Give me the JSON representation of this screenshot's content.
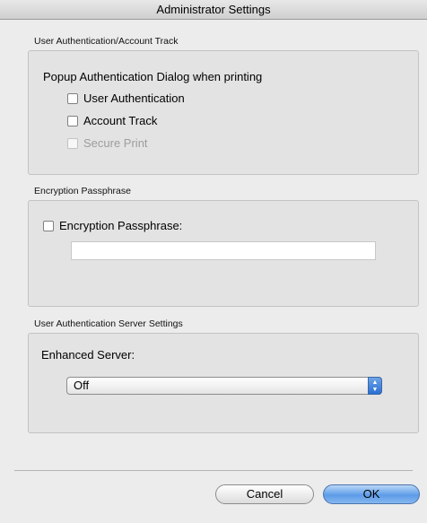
{
  "window": {
    "title": "Administrator Settings"
  },
  "user_auth_section": {
    "label": "User Authentication/Account Track",
    "popup_heading": "Popup Authentication Dialog when printing",
    "options": [
      {
        "label": "User Authentication",
        "checked": false,
        "enabled": true
      },
      {
        "label": "Account Track",
        "checked": false,
        "enabled": true
      },
      {
        "label": "Secure Print",
        "checked": false,
        "enabled": false
      }
    ]
  },
  "encryption_section": {
    "label": "Encryption Passphrase",
    "checkbox_label": "Encryption Passphrase:",
    "checked": false,
    "field_value": ""
  },
  "server_section": {
    "label": "User Authentication Server Settings",
    "enhanced_label": "Enhanced Server:",
    "selected": "Off"
  },
  "buttons": {
    "cancel": "Cancel",
    "ok": "OK"
  },
  "colors": {
    "default_button": "#5d9ce8",
    "popup_arrows": "#2a6ed4"
  },
  "icons": {
    "popup_arrows": "up-down-chevron-icon"
  }
}
